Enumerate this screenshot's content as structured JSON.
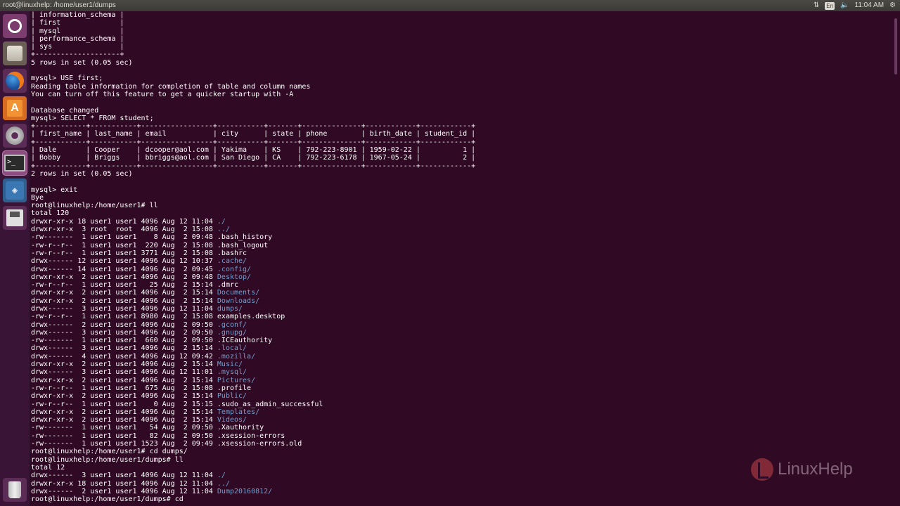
{
  "topbar": {
    "title": "root@linuxhelp: /home/user1/dumps",
    "keyboard_badge": "En",
    "clock": "11:04 AM",
    "icons": [
      "network-icon",
      "keyboard-icon",
      "volume-icon",
      "settings-gear-icon"
    ]
  },
  "launcher": {
    "items": [
      "dash-home-icon",
      "files-icon",
      "firefox-icon",
      "software-center-icon",
      "system-settings-icon",
      "terminal-icon",
      "mysql-workbench-icon",
      "floppy-disk-icon",
      "trash-icon"
    ],
    "software_letter": "A",
    "terminal_prompt": ">_"
  },
  "watermark": {
    "text": "LinuxHelp"
  },
  "colors": {
    "background": "#300a24",
    "text": "#ffffff",
    "directory": "#729fcf"
  },
  "terminal": {
    "lines": [
      {
        "t": "| information_schema |"
      },
      {
        "t": "| first              |"
      },
      {
        "t": "| mysql              |"
      },
      {
        "t": "| performance_schema |"
      },
      {
        "t": "| sys                |"
      },
      {
        "t": "+--------------------+"
      },
      {
        "t": "5 rows in set (0.05 sec)"
      },
      {
        "t": ""
      },
      {
        "t": "mysql> USE first;"
      },
      {
        "t": "Reading table information for completion of table and column names"
      },
      {
        "t": "You can turn off this feature to get a quicker startup with -A"
      },
      {
        "t": ""
      },
      {
        "t": "Database changed"
      },
      {
        "t": "mysql> SELECT * FROM student;"
      },
      {
        "t": "+------------+-----------+-----------------+-----------+-------+--------------+------------+------------+"
      },
      {
        "t": "| first_name | last_name | email           | city      | state | phone        | birth_date | student_id |"
      },
      {
        "t": "+------------+-----------+-----------------+-----------+-------+--------------+------------+------------+"
      },
      {
        "t": "| Dale       | Cooper    | dcooper@aol.com | Yakima    | KS    | 792-223-8901 | 1959-02-22 |          1 |"
      },
      {
        "t": "| Bobby      | Briggs    | bbriggs@aol.com | San Diego | CA    | 792-223-6178 | 1967-05-24 |          2 |"
      },
      {
        "t": "+------------+-----------+-----------------+-----------+-------+--------------+------------+------------+"
      },
      {
        "t": "2 rows in set (0.05 sec)"
      },
      {
        "t": ""
      },
      {
        "t": "mysql> exit"
      },
      {
        "t": "Bye"
      },
      {
        "t": "root@linuxhelp:/home/user1# ll"
      },
      {
        "t": "total 120"
      },
      {
        "t": "drwxr-xr-x 18 user1 user1 4096 Aug 12 11:04 ",
        "d": "./"
      },
      {
        "t": "drwxr-xr-x  3 root  root  4096 Aug  2 15:08 ",
        "d": "../"
      },
      {
        "t": "-rw-------  1 user1 user1    8 Aug  2 09:48 .bash_history"
      },
      {
        "t": "-rw-r--r--  1 user1 user1  220 Aug  2 15:08 .bash_logout"
      },
      {
        "t": "-rw-r--r--  1 user1 user1 3771 Aug  2 15:08 .bashrc"
      },
      {
        "t": "drwx------ 12 user1 user1 4096 Aug 12 10:37 ",
        "d": ".cache/"
      },
      {
        "t": "drwx------ 14 user1 user1 4096 Aug  2 09:45 ",
        "d": ".config/"
      },
      {
        "t": "drwxr-xr-x  2 user1 user1 4096 Aug  2 09:48 ",
        "d": "Desktop/"
      },
      {
        "t": "-rw-r--r--  1 user1 user1   25 Aug  2 15:14 .dmrc"
      },
      {
        "t": "drwxr-xr-x  2 user1 user1 4096 Aug  2 15:14 ",
        "d": "Documents/"
      },
      {
        "t": "drwxr-xr-x  2 user1 user1 4096 Aug  2 15:14 ",
        "d": "Downloads/"
      },
      {
        "t": "drwx------  3 user1 user1 4096 Aug 12 11:04 ",
        "d": "dumps/"
      },
      {
        "t": "-rw-r--r--  1 user1 user1 8980 Aug  2 15:08 examples.desktop"
      },
      {
        "t": "drwx------  2 user1 user1 4096 Aug  2 09:50 ",
        "d": ".gconf/"
      },
      {
        "t": "drwx------  3 user1 user1 4096 Aug  2 09:50 ",
        "d": ".gnupg/"
      },
      {
        "t": "-rw-------  1 user1 user1  660 Aug  2 09:50 .ICEauthority"
      },
      {
        "t": "drwx------  3 user1 user1 4096 Aug  2 15:14 ",
        "d": ".local/"
      },
      {
        "t": "drwx------  4 user1 user1 4096 Aug 12 09:42 ",
        "d": ".mozilla/"
      },
      {
        "t": "drwxr-xr-x  2 user1 user1 4096 Aug  2 15:14 ",
        "d": "Music/"
      },
      {
        "t": "drwx------  3 user1 user1 4096 Aug 12 11:01 ",
        "d": ".mysql/"
      },
      {
        "t": "drwxr-xr-x  2 user1 user1 4096 Aug  2 15:14 ",
        "d": "Pictures/"
      },
      {
        "t": "-rw-r--r--  1 user1 user1  675 Aug  2 15:08 .profile"
      },
      {
        "t": "drwxr-xr-x  2 user1 user1 4096 Aug  2 15:14 ",
        "d": "Public/"
      },
      {
        "t": "-rw-r--r--  1 user1 user1    0 Aug  2 15:15 .sudo_as_admin_successful"
      },
      {
        "t": "drwxr-xr-x  2 user1 user1 4096 Aug  2 15:14 ",
        "d": "Templates/"
      },
      {
        "t": "drwxr-xr-x  2 user1 user1 4096 Aug  2 15:14 ",
        "d": "Videos/"
      },
      {
        "t": "-rw-------  1 user1 user1   54 Aug  2 09:50 .Xauthority"
      },
      {
        "t": "-rw-------  1 user1 user1   82 Aug  2 09:50 .xsession-errors"
      },
      {
        "t": "-rw-------  1 user1 user1 1523 Aug  2 09:49 .xsession-errors.old"
      },
      {
        "t": "root@linuxhelp:/home/user1# cd dumps/"
      },
      {
        "t": "root@linuxhelp:/home/user1/dumps# ll"
      },
      {
        "t": "total 12"
      },
      {
        "t": "drwx------  3 user1 user1 4096 Aug 12 11:04 ",
        "d": "./"
      },
      {
        "t": "drwxr-xr-x 18 user1 user1 4096 Aug 12 11:04 ",
        "d": "../"
      },
      {
        "t": "drwx------  2 user1 user1 4096 Aug 12 11:04 ",
        "d": "Dump20160812/"
      },
      {
        "t": "root@linuxhelp:/home/user1/dumps# cd"
      }
    ]
  }
}
